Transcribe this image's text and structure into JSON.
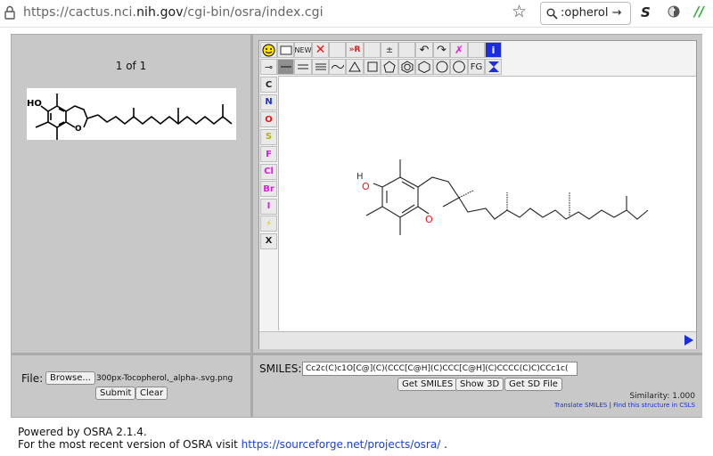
{
  "browser": {
    "url_prefix": "https://cactus.nci.",
    "url_domain": "nih.gov",
    "url_path": "/cgi-bin/osra/index.cgi",
    "search_text": ":opherol →"
  },
  "left_panel": {
    "pager": "1 of 1"
  },
  "editor": {
    "toolbar": {
      "new_label": "NEW",
      "fg_label": "FG",
      "elements": [
        {
          "symbol": "C",
          "color": "#222222"
        },
        {
          "symbol": "N",
          "color": "#1a2de0"
        },
        {
          "symbol": "O",
          "color": "#e01a1a"
        },
        {
          "symbol": "S",
          "color": "#b3b300"
        },
        {
          "symbol": "F",
          "color": "#e01ae0"
        },
        {
          "symbol": "Cl",
          "color": "#e01ae0"
        },
        {
          "symbol": "Br",
          "color": "#e01ae0"
        },
        {
          "symbol": "I",
          "color": "#e01ae0"
        },
        {
          "symbol": "⚡",
          "color": "#e6c200"
        },
        {
          "symbol": "X",
          "color": "#222222"
        }
      ]
    },
    "molecule": {
      "hydroxyl_h": "H",
      "hydroxyl_o": "O",
      "ring_o": "O"
    }
  },
  "file_form": {
    "label": "File:",
    "browse_label": "Browse...",
    "filename": "300px-Tocopherol,_alpha-.svg.png",
    "submit_label": "Submit",
    "clear_label": "Clear"
  },
  "smiles_form": {
    "label": "SMILES:",
    "value": "Cc2c(C)c1O[C@](C)(CCC[C@H](C)CCC[C@H](C)CCCC(C)C)CCc1c(",
    "get_smiles_label": "Get SMILES",
    "show3d_label": "Show 3D",
    "get_sd_label": "Get SD File",
    "similarity": "Similarity: 1.000",
    "translate_link": "Translate SMILES",
    "separator": "|",
    "csls_link": "Find this structure in CSLS"
  },
  "footer": {
    "powered": "Powered by OSRA 2.1.4.",
    "recent_prefix": "For the most recent version of OSRA visit",
    "recent_link": "https://sourceforge.net/projects/osra/",
    "recent_suffix": "."
  }
}
